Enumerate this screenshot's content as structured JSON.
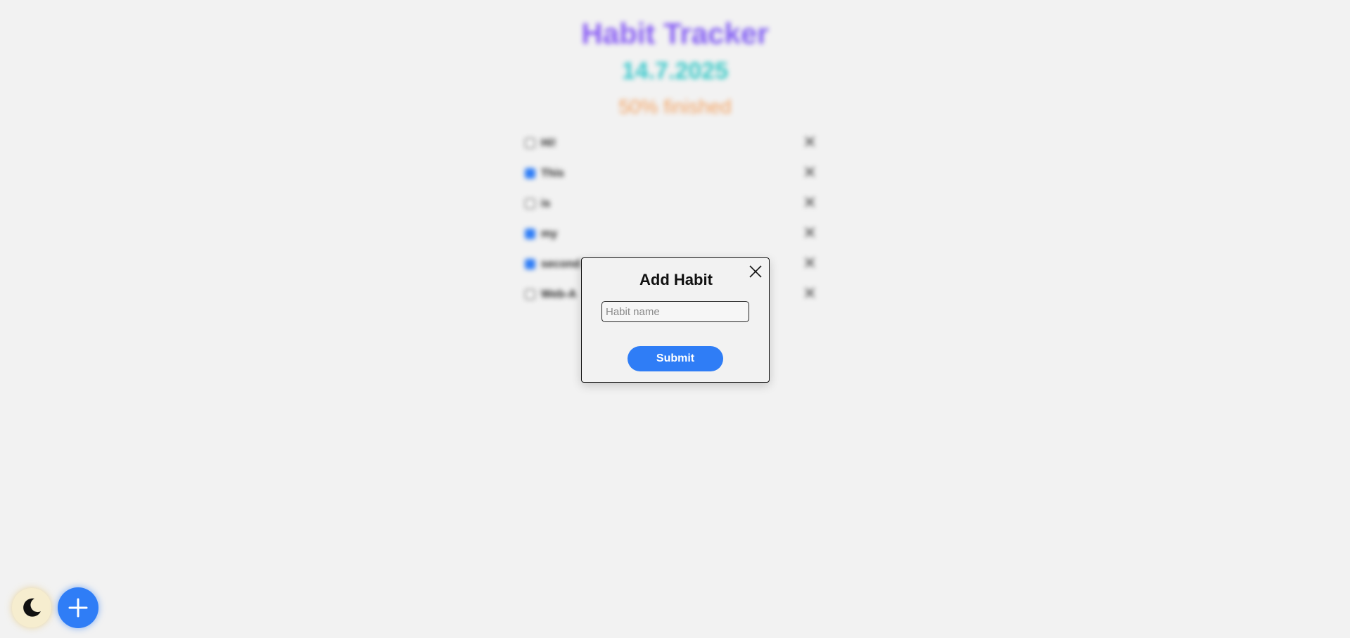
{
  "app": {
    "title": "Habit Tracker",
    "date": "14.7.2025",
    "progress_text": "50% finished",
    "progress_fraction": 0.5
  },
  "habits": [
    {
      "label": "Hi!",
      "checked": false
    },
    {
      "label": "This",
      "checked": true
    },
    {
      "label": "is",
      "checked": false
    },
    {
      "label": "my",
      "checked": true
    },
    {
      "label": "second",
      "checked": true
    },
    {
      "label": "Web-A",
      "checked": false
    }
  ],
  "modal": {
    "title": "Add Habit",
    "input_placeholder": "Habit name",
    "input_value": "",
    "submit_label": "Submit"
  },
  "colors": {
    "accent": "#2f7df6",
    "background": "#f2f2f2",
    "title_gradient": [
      "#a855f7",
      "#6366f1"
    ],
    "date_gradient": [
      "#38bdf8",
      "#34d399"
    ],
    "progress": "#f4a261"
  },
  "icons": {
    "theme_toggle": "moon-icon",
    "add": "plus-icon",
    "delete": "close-icon",
    "modal_close": "close-icon"
  }
}
